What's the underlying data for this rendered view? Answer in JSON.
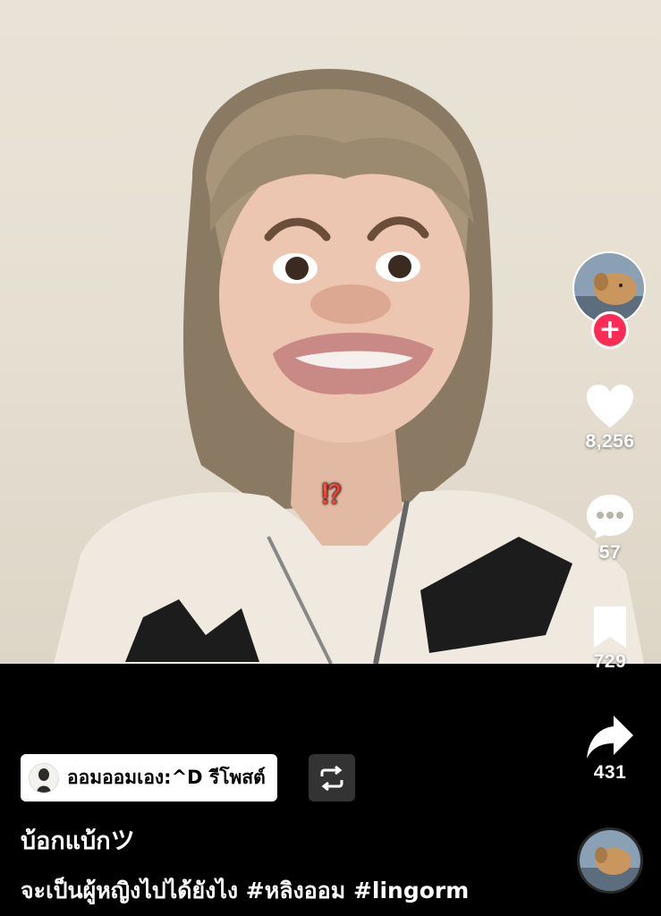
{
  "video": {
    "overlay_text": "⁉️"
  },
  "creator": {
    "avatar_icon": "dog-avatar",
    "follow_label": "+"
  },
  "actions": {
    "likes": "8,256",
    "comments": "57",
    "bookmarks": "729",
    "shares": "431"
  },
  "repost": {
    "label": "ออมออมเอง:^D รีโพสต์",
    "button_icon": "repost-icon"
  },
  "post": {
    "username": "บ้อกแบ้กツ",
    "caption": "จะเป็นผู้หญิงไปได้ยังไง #หลิงออม #lingorm"
  },
  "colors": {
    "accent": "#fe2c55",
    "background": "#000000"
  }
}
